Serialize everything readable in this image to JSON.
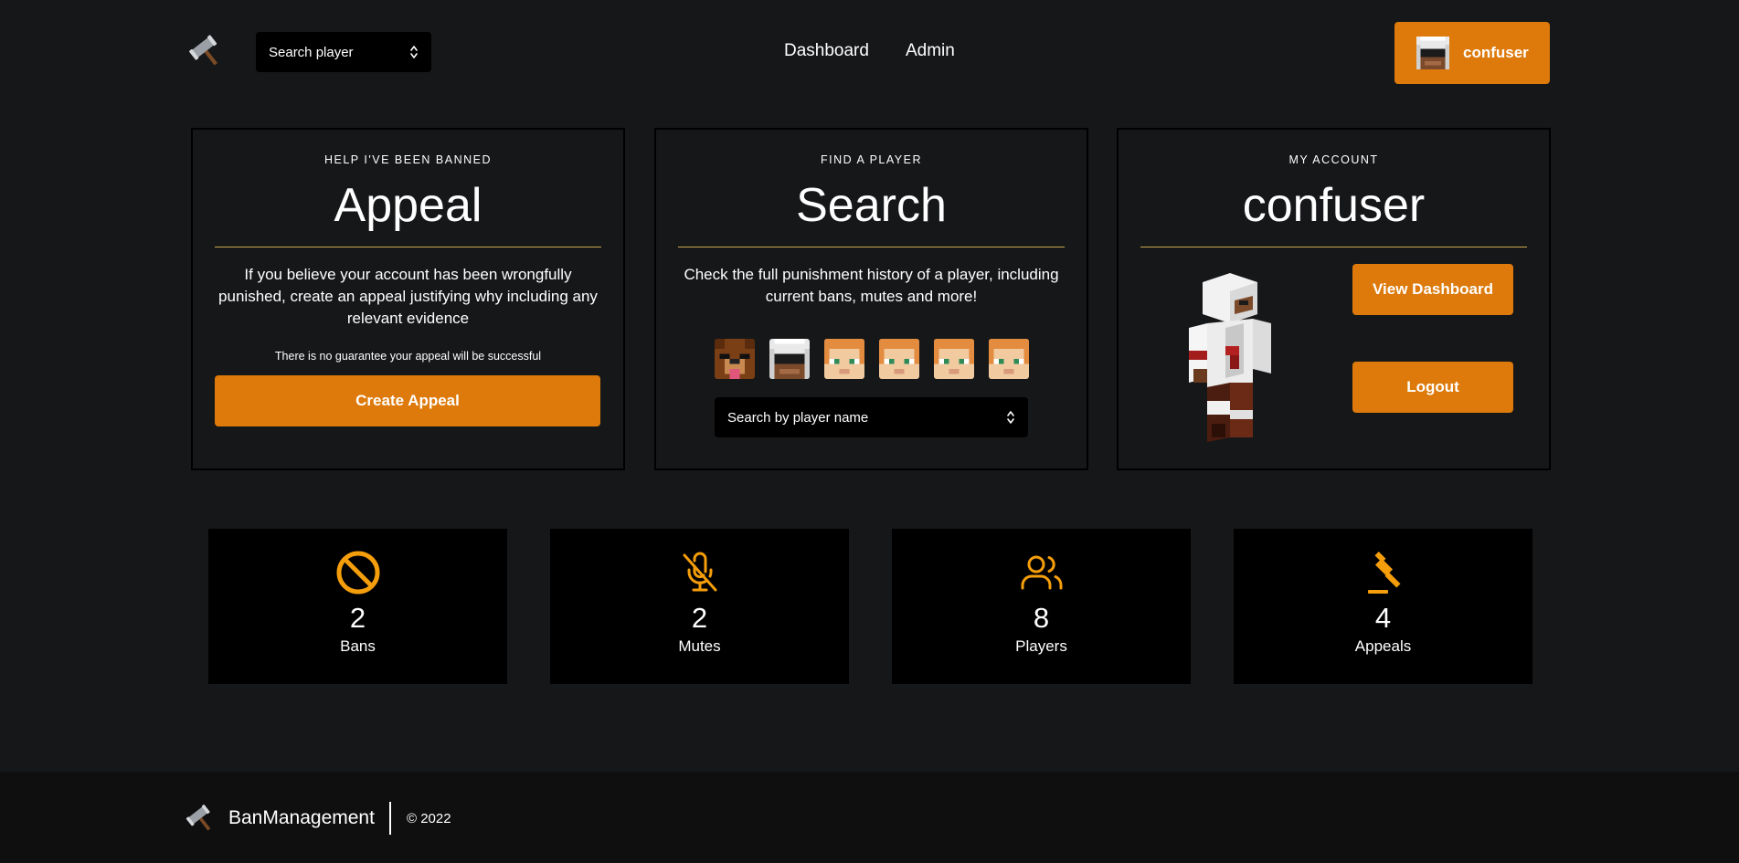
{
  "header": {
    "search_select": "Search player",
    "nav": [
      "Dashboard",
      "Admin"
    ],
    "user_name": "confuser"
  },
  "cards": {
    "appeal": {
      "eyebrow": "HELP I'VE BEEN BANNED",
      "title": "Appeal",
      "text": "If you believe your account has been wrongfully punished, create an appeal justifying why including any relevant evidence",
      "note": "There is no guarantee your appeal will be successful",
      "button": "Create Appeal"
    },
    "search": {
      "eyebrow": "FIND A PLAYER",
      "title": "Search",
      "text": "Check the full punishment history of a player, including current bans, mutes and more!",
      "select_placeholder": "Search by player name",
      "player_heads": [
        "bear-head",
        "confuser-head",
        "alex-head",
        "alex-head",
        "alex-head",
        "alex-head"
      ]
    },
    "account": {
      "eyebrow": "MY ACCOUNT",
      "title": "confuser",
      "view_button": "View Dashboard",
      "logout_button": "Logout"
    }
  },
  "stats": [
    {
      "icon": "ban-icon",
      "value": "2",
      "label": "Bans"
    },
    {
      "icon": "mic-off-icon",
      "value": "2",
      "label": "Mutes"
    },
    {
      "icon": "users-icon",
      "value": "8",
      "label": "Players"
    },
    {
      "icon": "gavel-icon",
      "value": "4",
      "label": "Appeals"
    }
  ],
  "footer": {
    "brand": "BanManagement",
    "copyright": "© 2022"
  },
  "colors": {
    "background": "#161719",
    "accent": "#dd7a0b",
    "stat_icon": "#f59e0b",
    "card_divider": "#c9a84e"
  }
}
